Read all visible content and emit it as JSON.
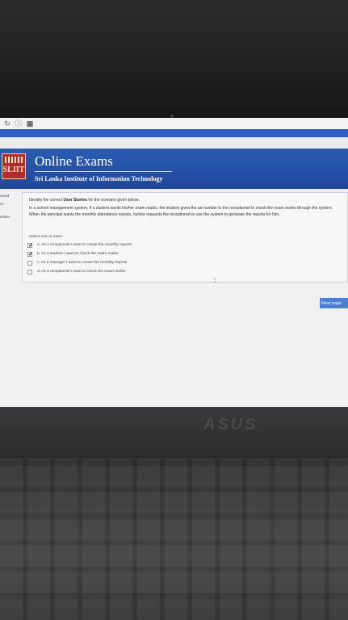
{
  "browser": {
    "icons": [
      "reload-icon",
      "info-icon",
      "bookmark-icon"
    ]
  },
  "header": {
    "logo_text": "SLIIT",
    "title": "Online Exams",
    "subtitle": "Sri Lanka Institute of Information Technology",
    "bar_color": "#2450a6"
  },
  "side": {
    "line1": "vered",
    "line2": "of",
    "line3": "estion"
  },
  "question": {
    "prompt_plain": "Identify the correct ",
    "prompt_bold": "User Stories",
    "prompt_rest": " for the scenario given below.",
    "scenario": "In a school management system, if a student wants his/her exam marks, the student gives the ad number to the receptionist to check the exam marks through the system. When the principal wants the monthly attendance reports, he/she requests the receptionist to use the system to generate the reports for him.",
    "select_label": "Select one or more:",
    "options": [
      {
        "text": "a. As a receptionist I want to create the monthly reports",
        "checked": true
      },
      {
        "text": "b. As a student I want to check the exam marks",
        "checked": true
      },
      {
        "text": "c. As a manager I want to create the monthly reports",
        "checked": false
      },
      {
        "text": "d. As a receptionist I want to check the exam marks",
        "checked": false
      }
    ]
  },
  "next_label": "Next page",
  "brand": "ASUS"
}
